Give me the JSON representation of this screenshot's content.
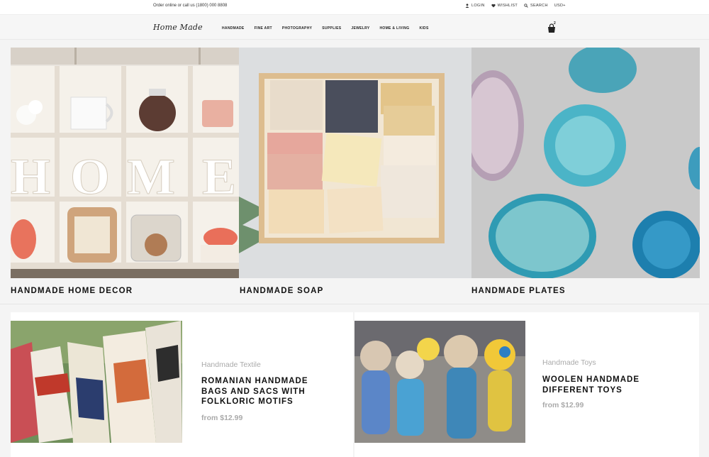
{
  "topbar": {
    "contact": "Order online or call us (1800) 000 8808",
    "links": [
      {
        "icon": "user-icon",
        "label": "LOGIN"
      },
      {
        "icon": "heart-icon",
        "label": "WISHLIST"
      },
      {
        "icon": "search-icon",
        "label": "SEARCH"
      },
      {
        "icon": "",
        "label": "USD+"
      }
    ]
  },
  "header": {
    "logo": "Home Made",
    "menu": [
      "HANDMADE",
      "FINE ART",
      "PHOTOGRAPHY",
      "SUPPLIES",
      "JEWELRY",
      "HOME & LIVING",
      "KIDS"
    ],
    "cart_count": "2"
  },
  "categories": [
    {
      "title": "HANDMADE HOME DECOR"
    },
    {
      "title": "HANDMADE SOAP"
    },
    {
      "title": "HANDMADE PLATES"
    }
  ],
  "products": [
    {
      "category": "Handmade Textile",
      "name_lines": [
        "ROMANIAN HANDMADE",
        "BAGS AND SACS WITH",
        "FOLKLORIC MOTIFS"
      ],
      "price": "from $12.99"
    },
    {
      "category": "Handmade Toys",
      "name_lines": [
        "WOOLEN HANDMADE",
        "DIFFERENT TOYS"
      ],
      "price": "from $12.99"
    }
  ],
  "colors": {
    "accent": "#111111",
    "muted": "#aaaaaa",
    "background": "#f4f4f4"
  }
}
